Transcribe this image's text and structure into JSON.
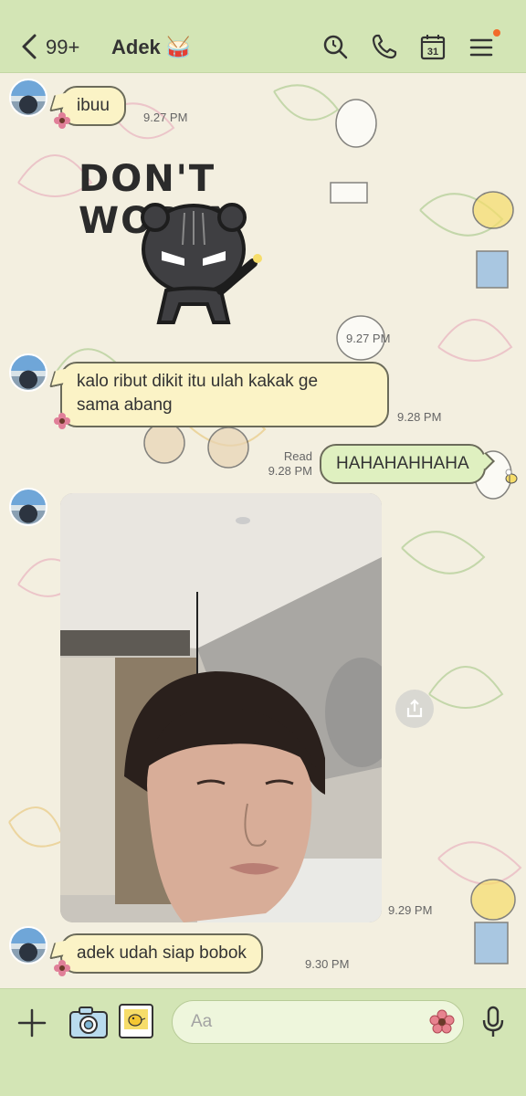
{
  "header": {
    "unread_count": "99+",
    "chat_name": "Adek",
    "icons": [
      "back-icon",
      "drum-emoji-icon",
      "search-icon",
      "phone-icon",
      "calendar-icon",
      "menu-icon"
    ],
    "calendar_day": "31"
  },
  "messages": [
    {
      "type": "text",
      "direction": "in",
      "text": "ibuu",
      "time": "9.27 PM"
    },
    {
      "type": "sticker",
      "direction": "in",
      "sticker_text": "DON'T WORRY",
      "time": "9.27 PM"
    },
    {
      "type": "text",
      "direction": "in",
      "lines": [
        "kalo ribut dikit itu ulah kakak ge",
        "sama abang"
      ],
      "time": "9.28 PM"
    },
    {
      "type": "text",
      "direction": "out",
      "text": "HAHAHAHHAHA",
      "time": "9.28 PM",
      "status": "Read"
    },
    {
      "type": "image",
      "direction": "in",
      "time": "9.29 PM"
    },
    {
      "type": "text",
      "direction": "in",
      "text": "adek udah siap bobok",
      "time": "9.30 PM"
    }
  ],
  "input": {
    "placeholder": "Aa"
  },
  "colors": {
    "header_bg": "#d3e5b5",
    "incoming_bubble": "#fbf3c6",
    "outgoing_bubble": "#dff0c0",
    "notification_dot": "#f26b2a"
  }
}
